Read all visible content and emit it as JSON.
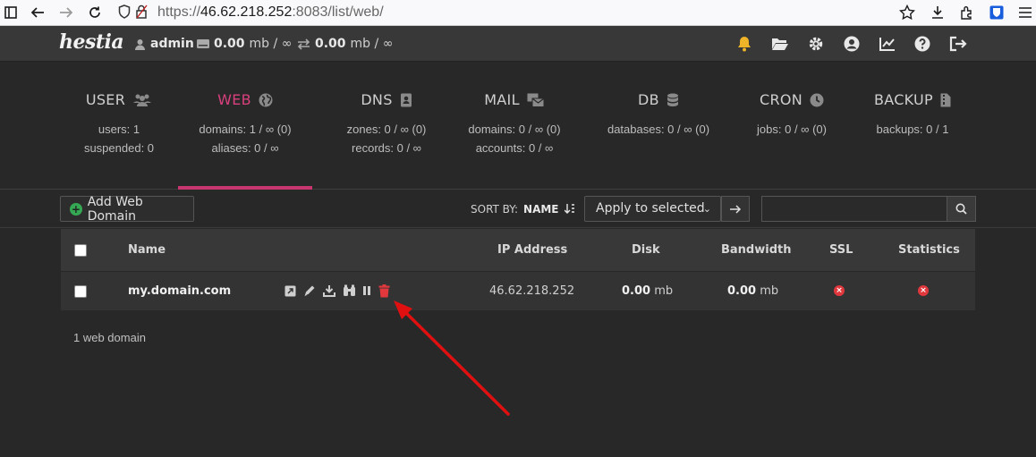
{
  "browser": {
    "url_scheme": "https://",
    "url_host": "46.62.218.252",
    "url_rest": ":8083/list/web/"
  },
  "topbar": {
    "logo": "hestia",
    "user": "admin",
    "disk_value": "0.00",
    "disk_unit": "mb / ∞",
    "bandwidth_value": "0.00",
    "bandwidth_unit": "mb / ∞",
    "bell_color": "#f0b428"
  },
  "tabs": [
    {
      "title": "USER",
      "line1": "users: 1",
      "line2": "suspended: 0"
    },
    {
      "title": "WEB",
      "line1": "domains: 1 / ∞ (0)",
      "line2": "aliases: 0 / ∞"
    },
    {
      "title": "DNS",
      "line1": "zones: 0 / ∞ (0)",
      "line2": "records: 0 / ∞"
    },
    {
      "title": "MAIL",
      "line1": "domains: 0 / ∞ (0)",
      "line2": "accounts: 0 / ∞"
    },
    {
      "title": "DB",
      "line1": "databases: 0 / ∞ (0)",
      "line2": ""
    },
    {
      "title": "CRON",
      "line1": "jobs: 0 / ∞ (0)",
      "line2": ""
    },
    {
      "title": "BACKUP",
      "line1": "backups: 0 / 1",
      "line2": ""
    }
  ],
  "active_tab": "WEB",
  "toolbar": {
    "add_label": "Add Web Domain",
    "sort_label": "SORT BY:",
    "sort_value": "NAME",
    "bulk_action": "Apply to selected"
  },
  "table": {
    "headers": {
      "name": "Name",
      "ip": "IP Address",
      "disk": "Disk",
      "bandwidth": "Bandwidth",
      "ssl": "SSL",
      "stats": "Statistics"
    },
    "rows": [
      {
        "name": "my.domain.com",
        "ip": "46.62.218.252",
        "disk_value": "0.00",
        "disk_unit": "mb",
        "bw_value": "0.00",
        "bw_unit": "mb",
        "ssl": "disabled",
        "stats": "disabled"
      }
    ]
  },
  "footer": {
    "count": "1 web domain"
  },
  "colors": {
    "accent": "#d8407d",
    "delete_icon": "#e0383d",
    "annotation_arrow": "#e01010"
  }
}
